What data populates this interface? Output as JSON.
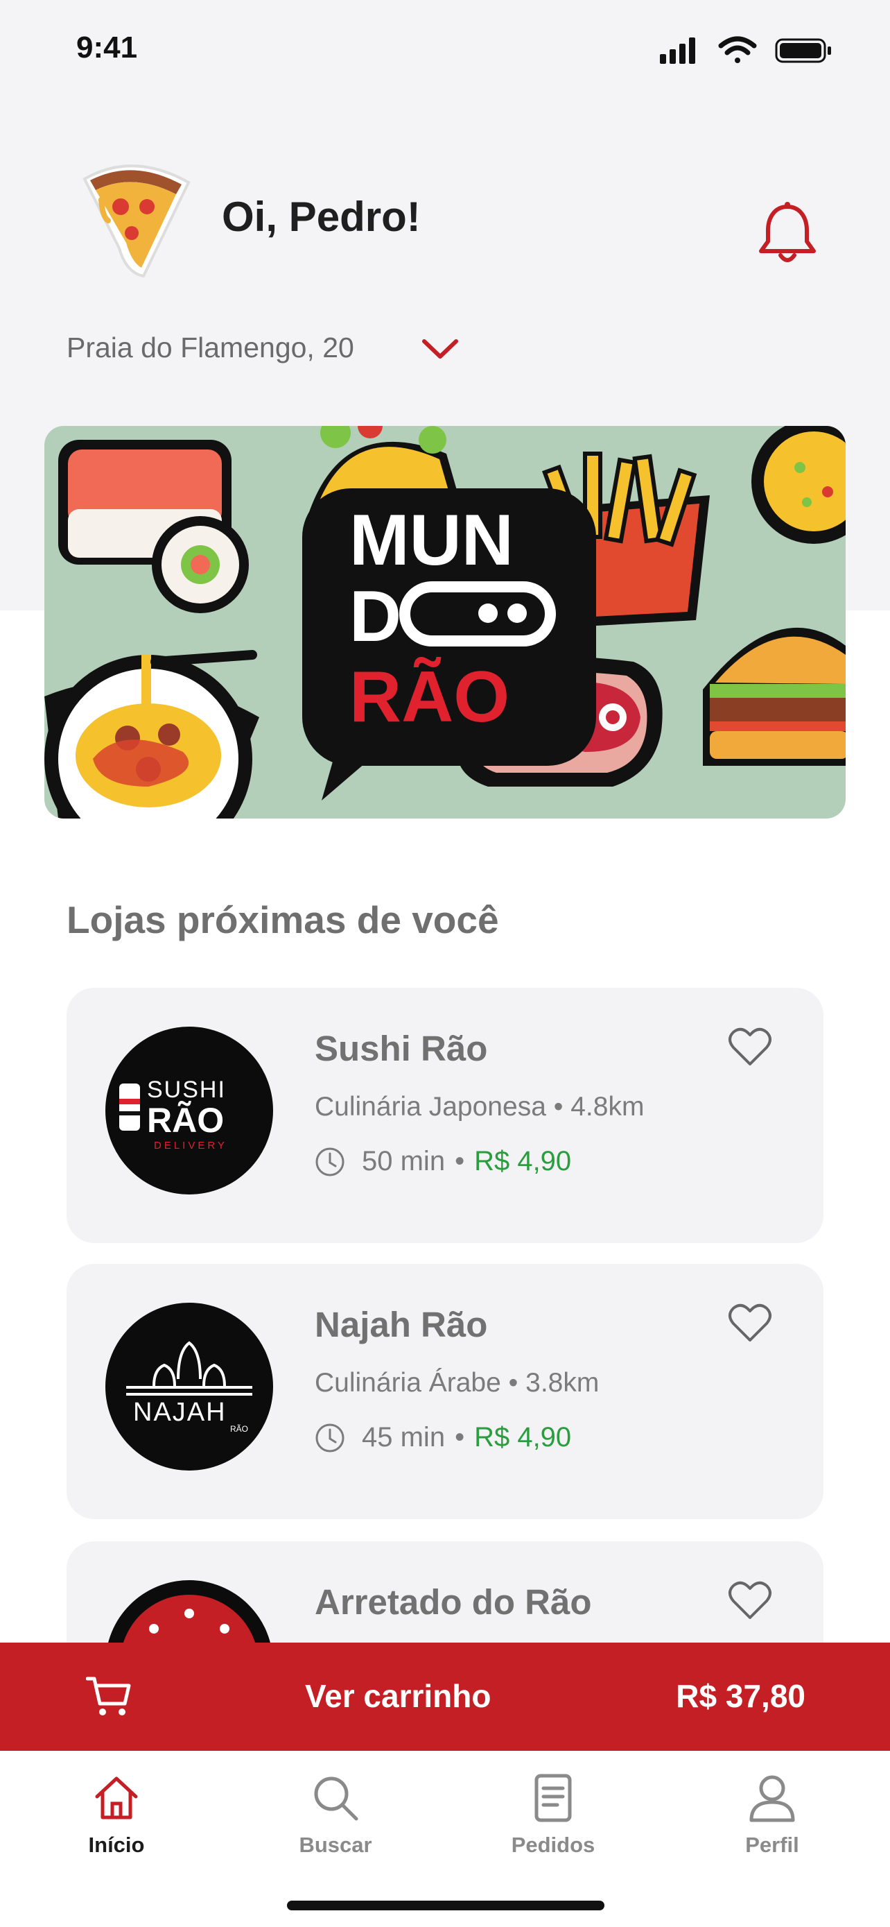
{
  "status_bar": {
    "time": "9:41"
  },
  "header": {
    "greeting": "Oi, Pedro!",
    "address": "Praia do Flamengo, 20",
    "avatar_icon": "pizza-slice-avatar",
    "notification_icon": "bell-icon"
  },
  "banner": {
    "brand_line1": "MUN",
    "brand_line2": "D",
    "brand_line3": "RÃO"
  },
  "section": {
    "title": "Lojas próximas de você"
  },
  "stores": [
    {
      "name": "Sushi Rão",
      "cuisine": "Culinária Japonesa",
      "distance": "4.8km",
      "time": "50 min",
      "fee": "R$ 4,90",
      "logo_line1": "SUSHI",
      "logo_line2": "RÃO",
      "logo_line3": "DELIVERY"
    },
    {
      "name": "Najah Rão",
      "cuisine": "Culinária Árabe",
      "distance": "3.8km",
      "time": "45 min",
      "fee": "R$ 4,90",
      "logo_line1": "NAJAH",
      "logo_line2": "RÃO"
    },
    {
      "name": "Arretado do Rão"
    }
  ],
  "separator": "•",
  "cart": {
    "label": "Ver carrinho",
    "total": "R$ 37,80"
  },
  "tabs": [
    {
      "label": "Início",
      "icon": "home-icon",
      "active": true
    },
    {
      "label": "Buscar",
      "icon": "search-icon"
    },
    {
      "label": "Pedidos",
      "icon": "orders-icon"
    },
    {
      "label": "Perfil",
      "icon": "profile-icon"
    }
  ],
  "colors": {
    "accent": "#c41f24",
    "fee_green": "#2a9d3f",
    "header_bg": "#f4f3f5",
    "banner_bg": "#b4cfb9"
  }
}
